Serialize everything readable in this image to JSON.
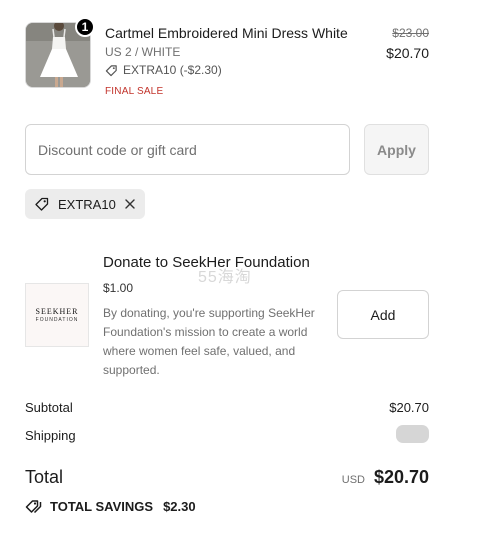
{
  "product": {
    "quantity": "1",
    "title": "Cartmel Embroidered Mini Dress White",
    "variant": "US 2 / WHITE",
    "discount_code_line": "EXTRA10 (-$2.30)",
    "final_sale": "FINAL SALE",
    "original_price": "$23.00",
    "price": "$20.70"
  },
  "discount": {
    "placeholder": "Discount code or gift card",
    "apply_label": "Apply",
    "applied_code": "EXTRA10"
  },
  "donation": {
    "title": "Donate to SeekHer Foundation",
    "amount": "$1.00",
    "description": "By donating, you're supporting SeekHer Foundation's mission to create a world where women feel safe, valued, and supported.",
    "logo_line1": "SEEKHER",
    "logo_line2": "FOUNDATION",
    "add_label": "Add"
  },
  "watermark": "55海淘",
  "summary": {
    "subtotal_label": "Subtotal",
    "subtotal_value": "$20.70",
    "shipping_label": "Shipping",
    "total_label": "Total",
    "currency": "USD",
    "total_value": "$20.70",
    "savings_label": "TOTAL SAVINGS",
    "savings_value": "$2.30"
  }
}
